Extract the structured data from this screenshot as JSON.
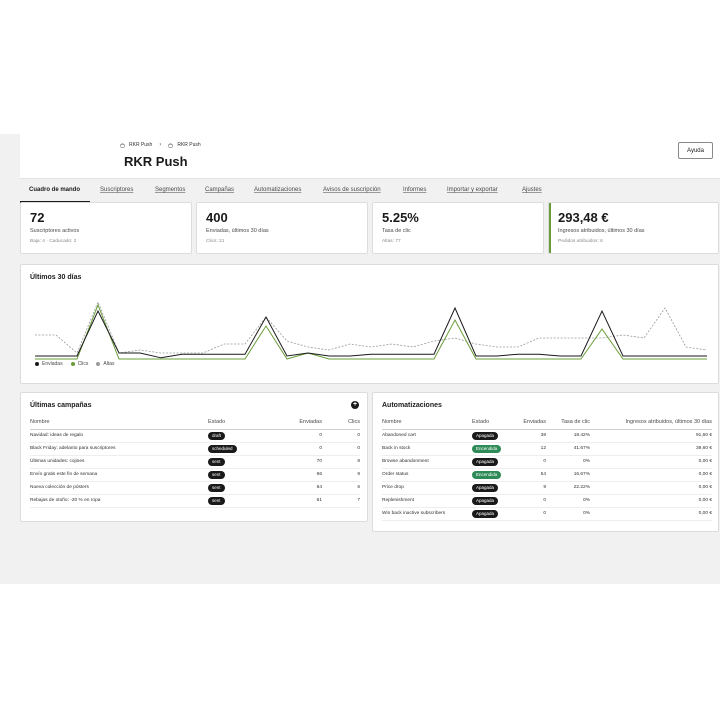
{
  "header": {
    "breadcrumb": [
      "RKR Push",
      "RKR Push"
    ],
    "title": "RKR Push",
    "help_label": "Ayuda"
  },
  "tabs": [
    {
      "label": "Cuadro de mando",
      "active": true
    },
    {
      "label": "Suscriptores"
    },
    {
      "label": "Segmentos"
    },
    {
      "label": "Campañas"
    },
    {
      "label": "Automatizaciones"
    },
    {
      "label": "Avisos de suscripción"
    },
    {
      "label": "Informes"
    },
    {
      "label": "Importar y exportar"
    },
    {
      "label": "Ajustes"
    }
  ],
  "kpis": [
    {
      "value": "72",
      "label": "Suscriptores activos",
      "sub": "Baja: 4 · Caducado: 2"
    },
    {
      "value": "400",
      "label": "Enviadas, últimos 30 días",
      "sub": "Clics: 21"
    },
    {
      "value": "5.25%",
      "label": "Tasa de clic",
      "sub": "Altas: 77"
    },
    {
      "value": "293,48 €",
      "label": "Ingresos atribuidos, últimos 30 días",
      "sub": "Pedidos atribuidos: 6"
    }
  ],
  "chart_section": {
    "title": "Últimos 30 días",
    "legend": [
      {
        "name": "Enviadas",
        "color": "#1a1a1a"
      },
      {
        "name": "Clics",
        "color": "#6a9c3a"
      },
      {
        "name": "Altas",
        "color": "#9a9a9a"
      }
    ]
  },
  "chart_data": {
    "type": "line",
    "x_count": 30,
    "ylim": [
      0,
      100
    ],
    "series": [
      {
        "name": "Enviadas",
        "color": "#1a1a1a",
        "dashed": false,
        "values": [
          5,
          5,
          5,
          80,
          10,
          10,
          2,
          8,
          8,
          8,
          8,
          70,
          5,
          10,
          5,
          5,
          8,
          8,
          8,
          8,
          85,
          5,
          5,
          8,
          8,
          5,
          5,
          80,
          5,
          5,
          5,
          5,
          5
        ]
      },
      {
        "name": "Clics",
        "color": "#6a9c3a",
        "dashed": false,
        "values": [
          0,
          0,
          0,
          90,
          0,
          0,
          0,
          0,
          0,
          0,
          0,
          55,
          0,
          10,
          0,
          0,
          0,
          0,
          0,
          0,
          65,
          0,
          0,
          0,
          0,
          0,
          0,
          50,
          0,
          0,
          0,
          0,
          0
        ]
      },
      {
        "name": "Altas",
        "color": "#9a9a9a",
        "dashed": true,
        "values": [
          40,
          40,
          10,
          95,
          10,
          15,
          10,
          10,
          10,
          25,
          25,
          70,
          30,
          20,
          15,
          25,
          20,
          25,
          20,
          30,
          35,
          25,
          20,
          20,
          35,
          35,
          35,
          35,
          40,
          35,
          85,
          20,
          15
        ]
      }
    ]
  },
  "campaigns": {
    "title": "Últimas campañas",
    "columns": [
      "Nombre",
      "Estado",
      "Enviadas",
      "Clics"
    ],
    "rows": [
      {
        "name": "Navidad: ideas de regalo",
        "status": "draft",
        "sent": "0",
        "clicks": "0"
      },
      {
        "name": "Black Friday: adelanto para suscriptores",
        "status": "scheduled",
        "sent": "0",
        "clicks": "0"
      },
      {
        "name": "Últimas unidades: cojines",
        "status": "sent",
        "sent": "70",
        "clicks": "8"
      },
      {
        "name": "Envío gratis este fin de semana",
        "status": "sent",
        "sent": "66",
        "clicks": "9"
      },
      {
        "name": "Nueva colección de pósters",
        "status": "sent",
        "sent": "64",
        "clicks": "6"
      },
      {
        "name": "Rebajas de otoño: -20 % en ropa",
        "status": "sent",
        "sent": "61",
        "clicks": "7"
      }
    ]
  },
  "automations": {
    "title": "Automatizaciones",
    "columns": [
      "Nombre",
      "Estado",
      "Enviadas",
      "Tasa de clic",
      "Ingresos atribuidos, últimos 30 días"
    ],
    "rows": [
      {
        "name": "Abandoned cart",
        "status": "Apagada",
        "on": false,
        "sent": "38",
        "rate": "18.42%",
        "revenue": "91,60 €"
      },
      {
        "name": "Back in stock",
        "status": "Encendida",
        "on": true,
        "sent": "12",
        "rate": "41.67%",
        "revenue": "39,60 €"
      },
      {
        "name": "Browse abandonment",
        "status": "Apagada",
        "on": false,
        "sent": "0",
        "rate": "0%",
        "revenue": "0,00 €"
      },
      {
        "name": "Order status",
        "status": "Encendida",
        "on": true,
        "sent": "54",
        "rate": "16.67%",
        "revenue": "0,00 €"
      },
      {
        "name": "Price drop",
        "status": "Apagada",
        "on": false,
        "sent": "9",
        "rate": "22.22%",
        "revenue": "0,00 €"
      },
      {
        "name": "Replenishment",
        "status": "Apagada",
        "on": false,
        "sent": "0",
        "rate": "0%",
        "revenue": "0,00 €"
      },
      {
        "name": "Win back inactive subscribers",
        "status": "Apagada",
        "on": false,
        "sent": "0",
        "rate": "0%",
        "revenue": "0,00 €"
      }
    ]
  }
}
